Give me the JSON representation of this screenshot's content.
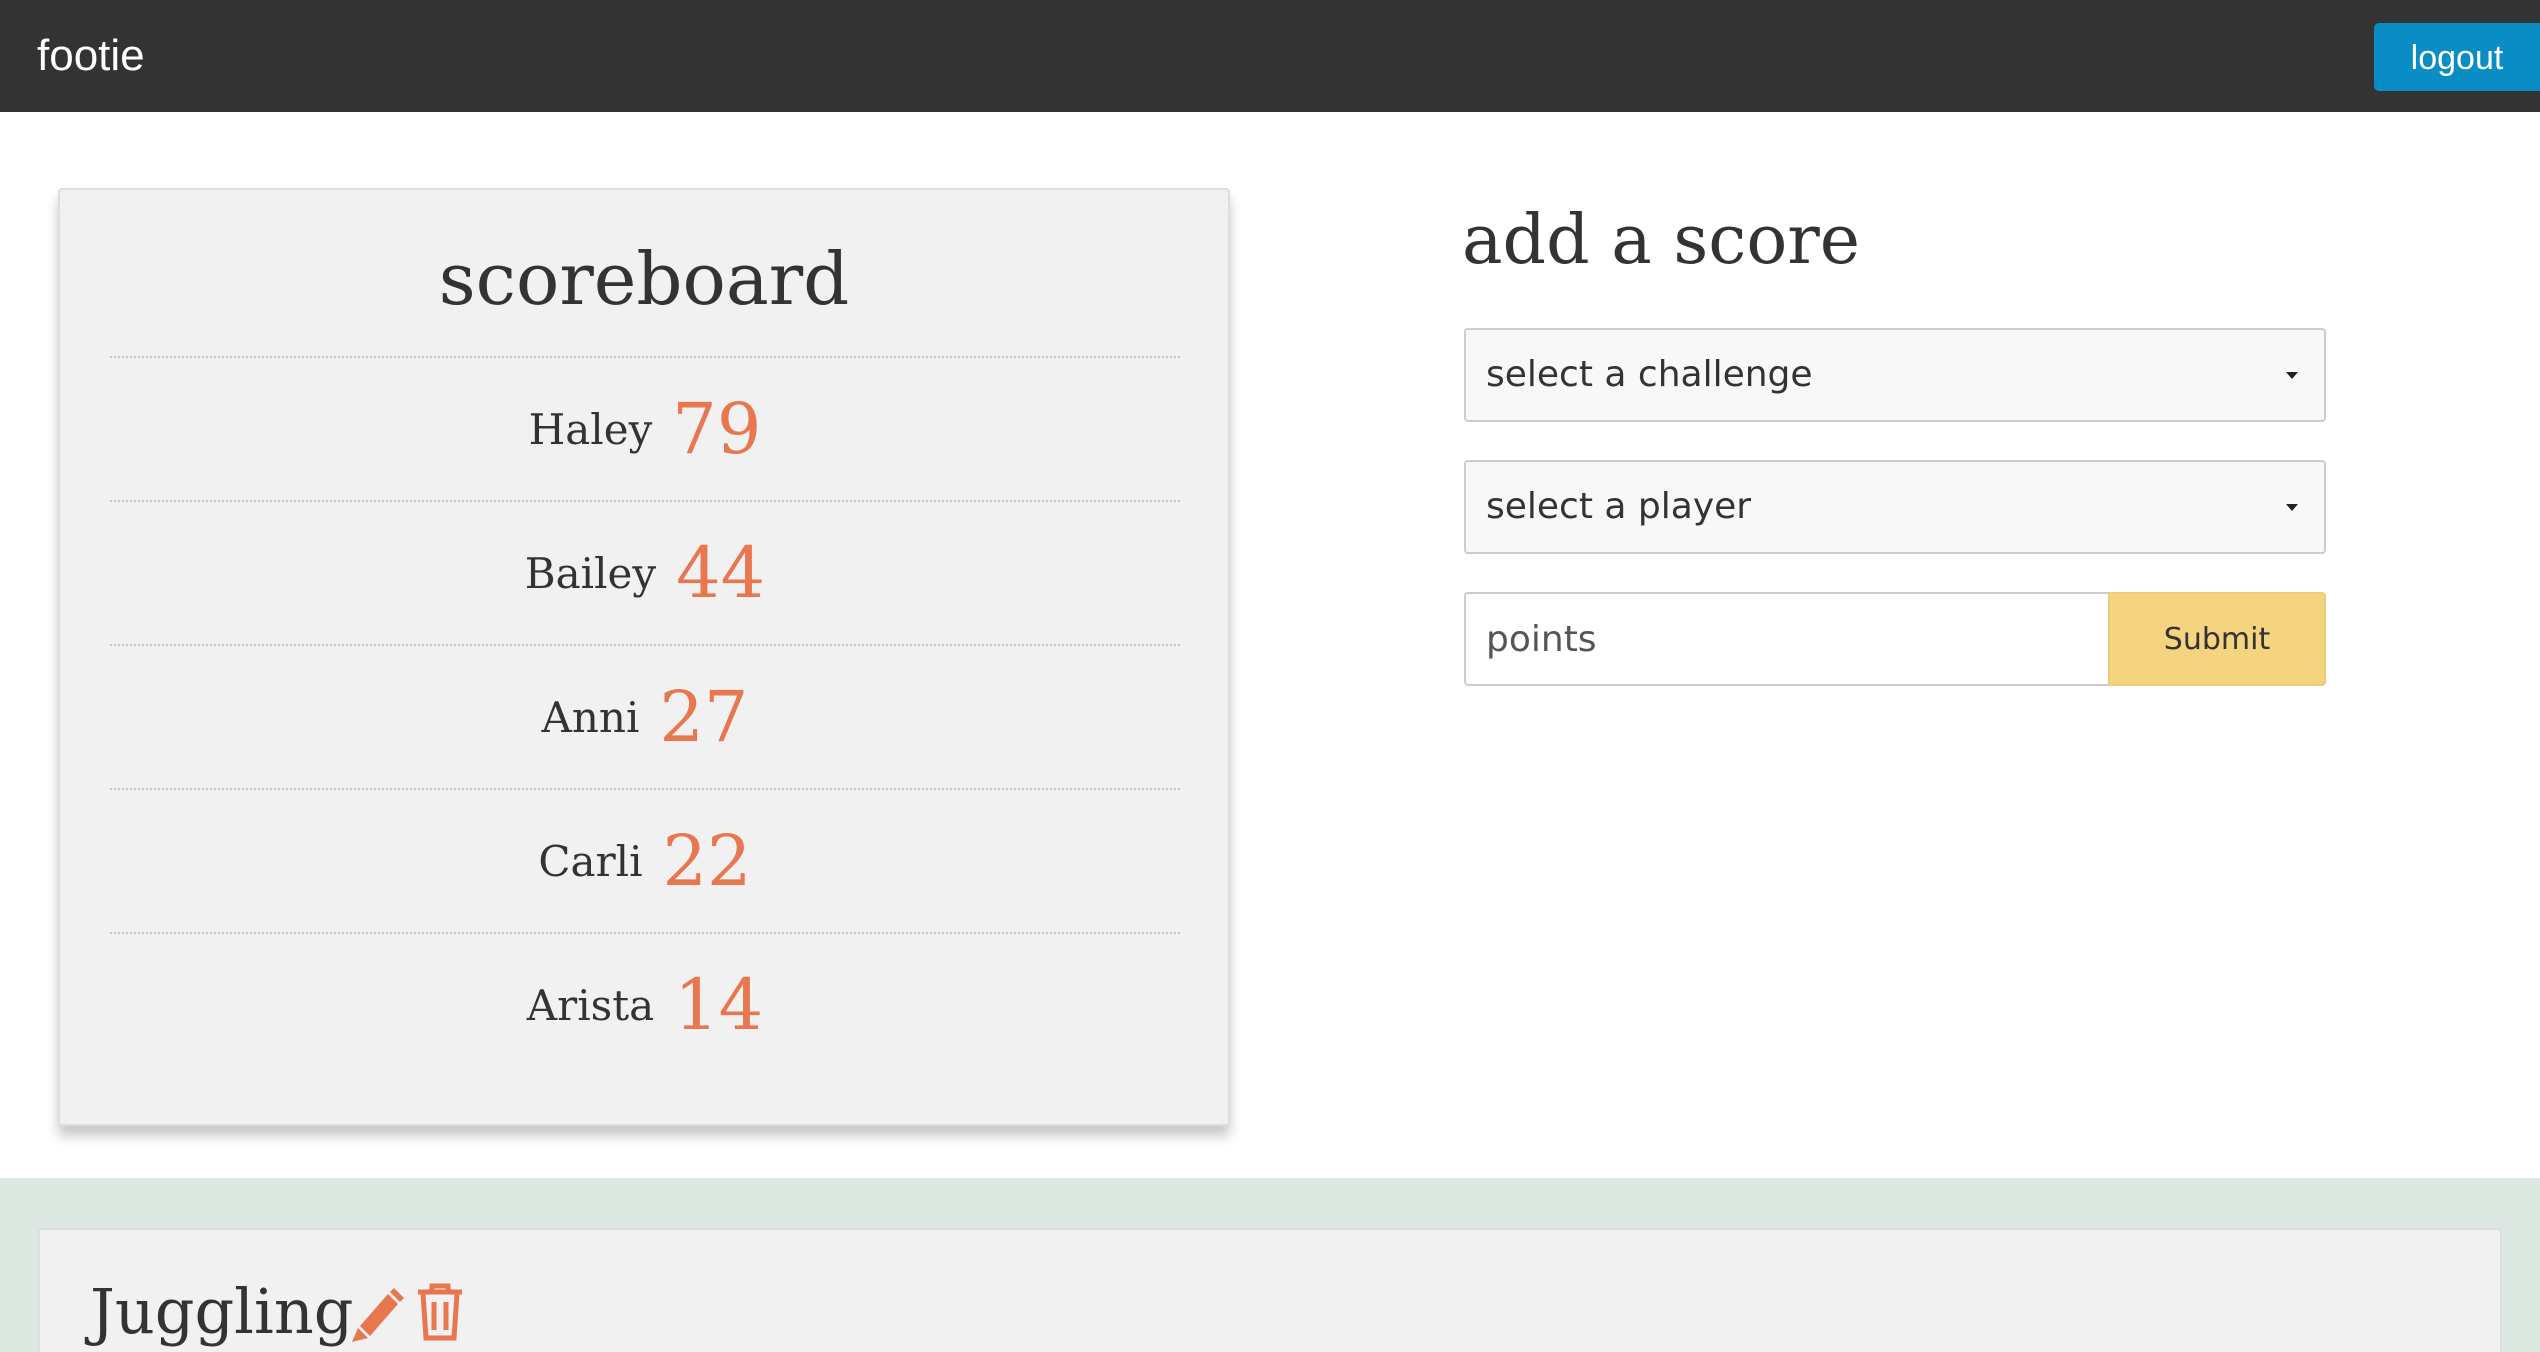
{
  "header": {
    "brand": "footie",
    "logout_label": "logout"
  },
  "scoreboard": {
    "title": "scoreboard",
    "rows": [
      {
        "name": "Haley",
        "score": "79"
      },
      {
        "name": "Bailey",
        "score": "44"
      },
      {
        "name": "Anni",
        "score": "27"
      },
      {
        "name": "Carli",
        "score": "22"
      },
      {
        "name": "Arista",
        "score": "14"
      }
    ]
  },
  "add_score": {
    "title": "add a score",
    "challenge_select": "select a challenge",
    "player_select": "select a player",
    "points_placeholder": "points",
    "submit_label": "Submit"
  },
  "challenge": {
    "title": "Juggling",
    "edit_icon": "pencil-icon",
    "delete_icon": "trash-icon"
  },
  "colors": {
    "topbar": "#333333",
    "logout": "#0a8cc4",
    "score_accent": "#e8764e",
    "submit": "#f4d47f",
    "lower_band": "#dde8e3"
  }
}
